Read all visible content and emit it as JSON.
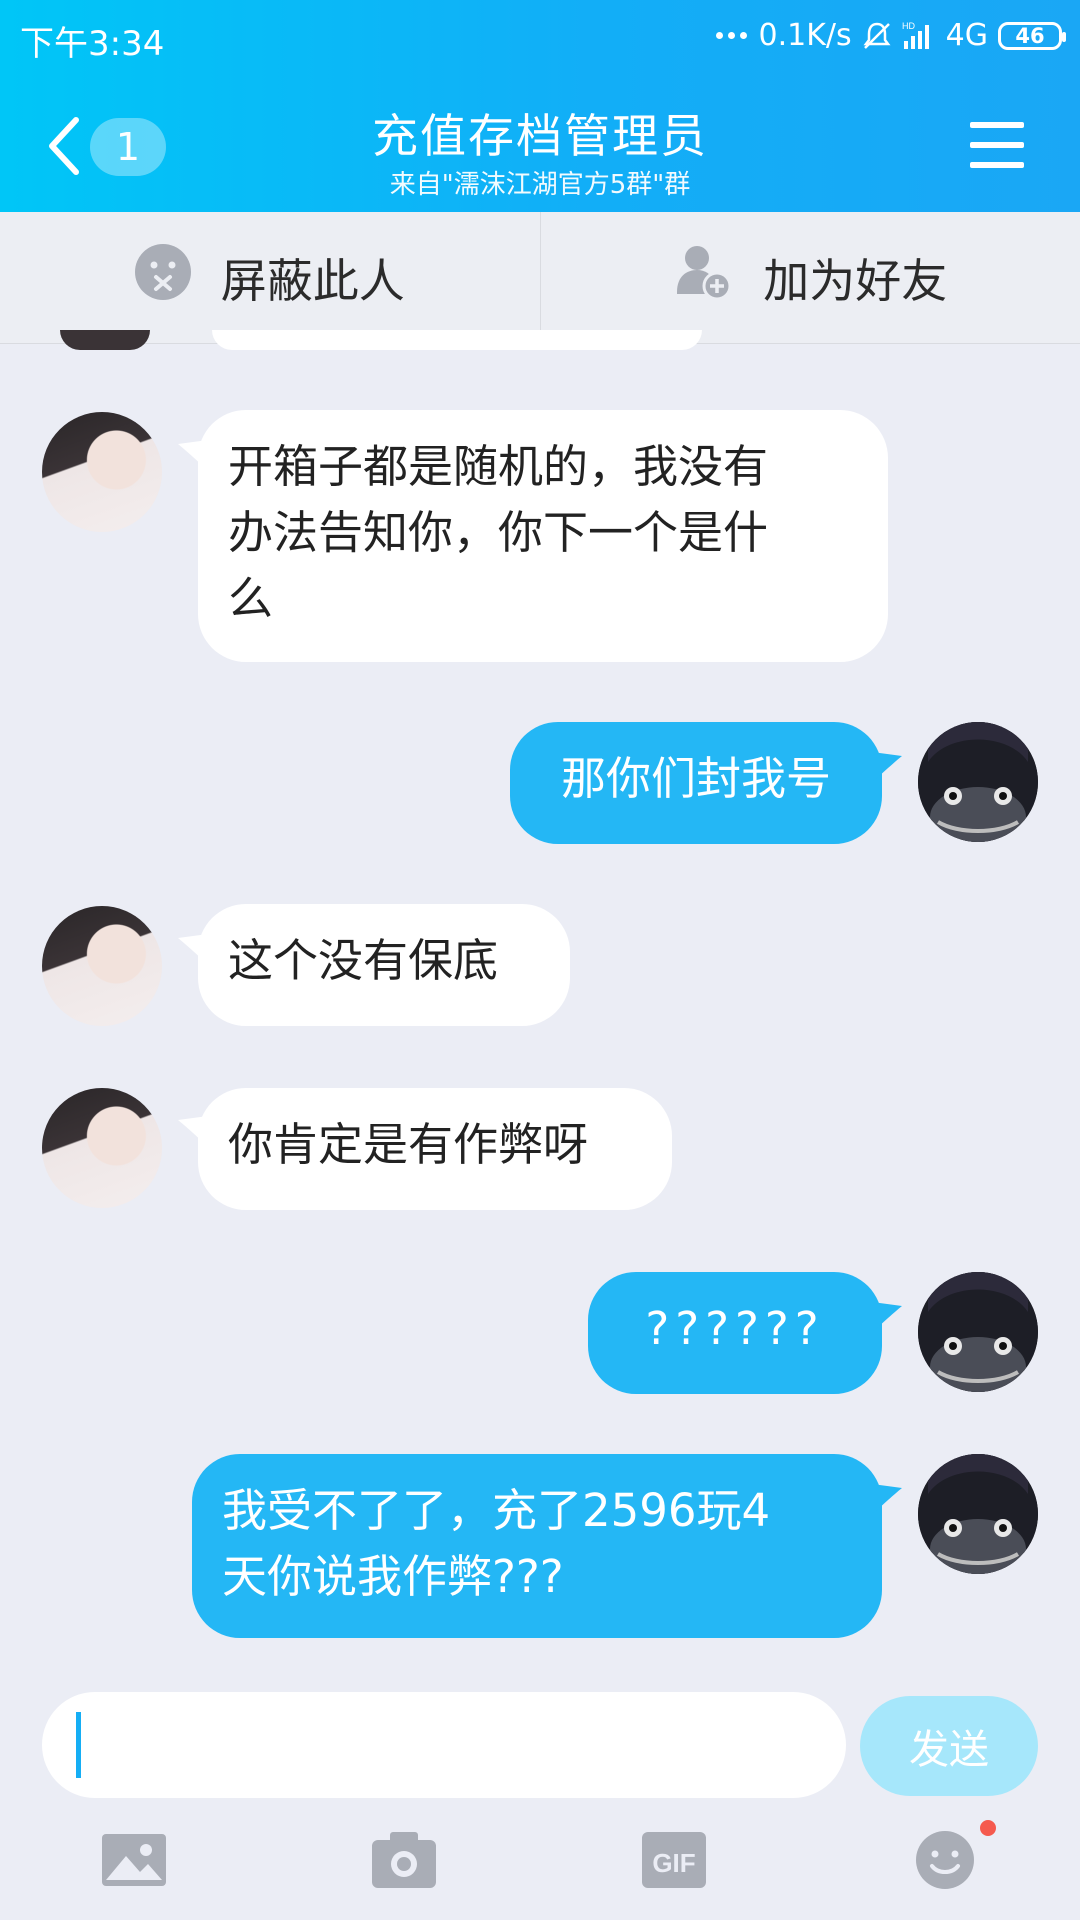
{
  "status": {
    "time": "下午3:34",
    "network_speed": "0.1K/s",
    "network_type": "4G",
    "battery": "46"
  },
  "header": {
    "back_badge": "1",
    "title": "充值存档管理员",
    "subtitle": "来自\"濡沫江湖官方5群\"群"
  },
  "actions": {
    "block_label": "屏蔽此人",
    "add_friend_label": "加为好友"
  },
  "messages": [
    {
      "from": "other",
      "text_lines": [
        "开箱子都是随机的，我没有",
        "办法告知你，你下一个是什",
        "么"
      ]
    },
    {
      "from": "me",
      "text_lines": [
        "那你们封我号"
      ]
    },
    {
      "from": "other",
      "text_lines": [
        "这个没有保底"
      ]
    },
    {
      "from": "other",
      "text_lines": [
        "你肯定是有作弊呀"
      ]
    },
    {
      "from": "me",
      "text_lines": [
        "??????"
      ]
    },
    {
      "from": "me",
      "text_lines": [
        "我受不了了，充了2596玩4",
        "天你说我作弊???"
      ]
    }
  ],
  "composer": {
    "send_label": "发送"
  },
  "toolbar": {
    "gif_label": "GIF"
  },
  "colors": {
    "header_start": "#00c6f7",
    "header_end": "#1aa7f5",
    "bubble_out": "#24b7f5",
    "bubble_in": "#ffffff",
    "background": "#ebedf5"
  }
}
